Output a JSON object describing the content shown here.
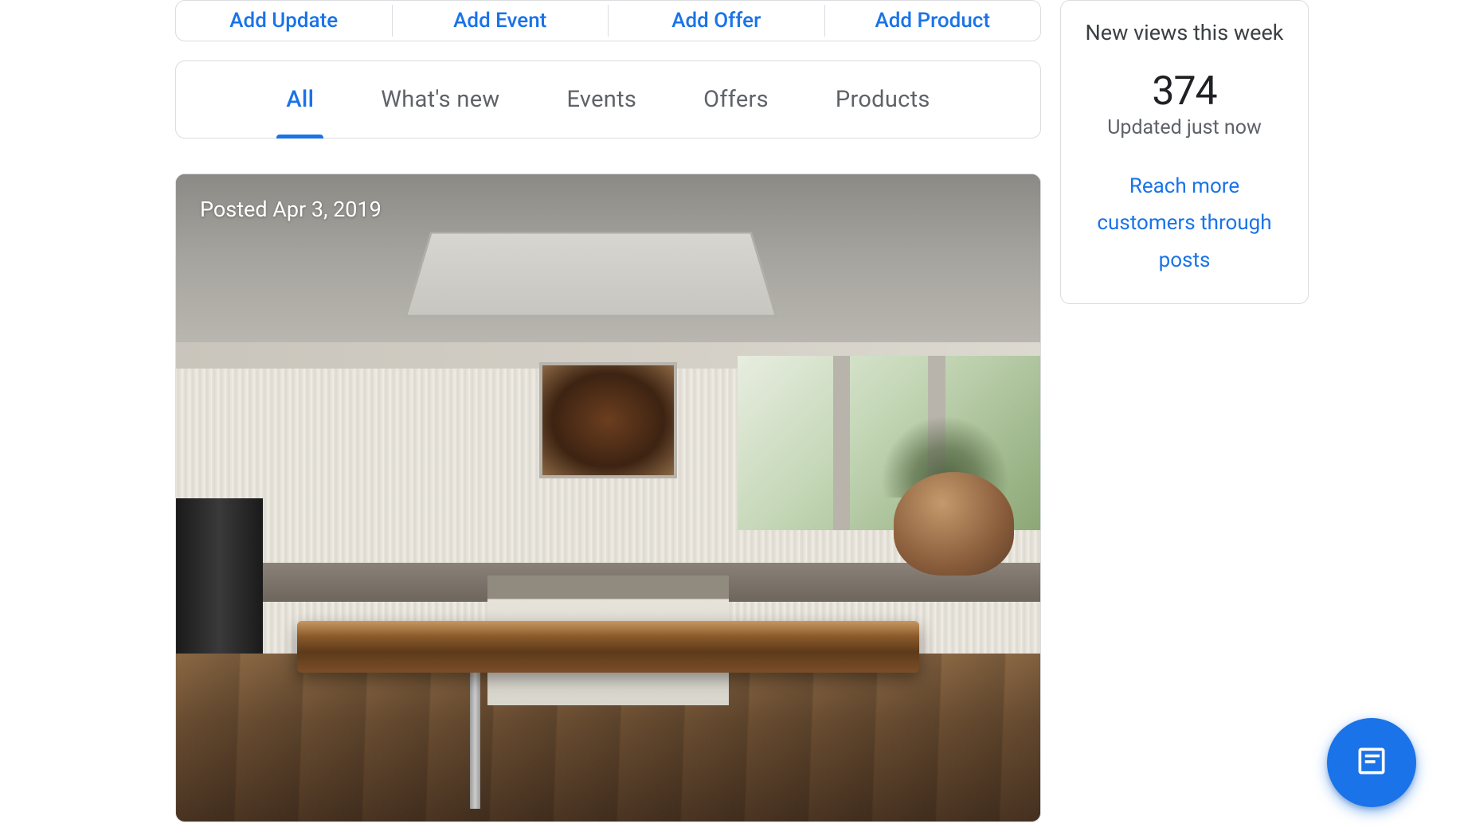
{
  "actionBar": {
    "addUpdate": "Add Update",
    "addEvent": "Add Event",
    "addOffer": "Add Offer",
    "addProduct": "Add Product"
  },
  "tabs": {
    "all": "All",
    "whatsNew": "What's new",
    "events": "Events",
    "offers": "Offers",
    "products": "Products"
  },
  "post": {
    "dateLabel": "Posted Apr 3, 2019"
  },
  "sidebar": {
    "title": "New views this week",
    "count": "374",
    "updated": "Updated just now",
    "link": "Reach more customers through posts"
  }
}
